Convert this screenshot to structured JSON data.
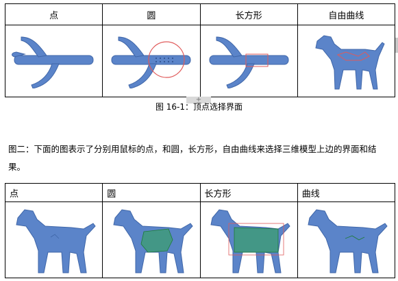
{
  "table1": {
    "headers": [
      "点",
      "圆",
      "长方形",
      "自由曲线"
    ]
  },
  "caption": "图 16-1：顶点选择界面",
  "paragraph": "图二：下面的图表示了分别用鼠标的点，和圆，长方形，自由曲线来选择三维模型上边的界面和结果。",
  "table2": {
    "headers": [
      "点",
      "圆",
      "长方形",
      "曲线"
    ]
  },
  "colors": {
    "model": "#5b84c9",
    "selection_outline": "#e05a5a",
    "selected_mesh": "#2fa84f"
  },
  "ruler_mark": "+"
}
